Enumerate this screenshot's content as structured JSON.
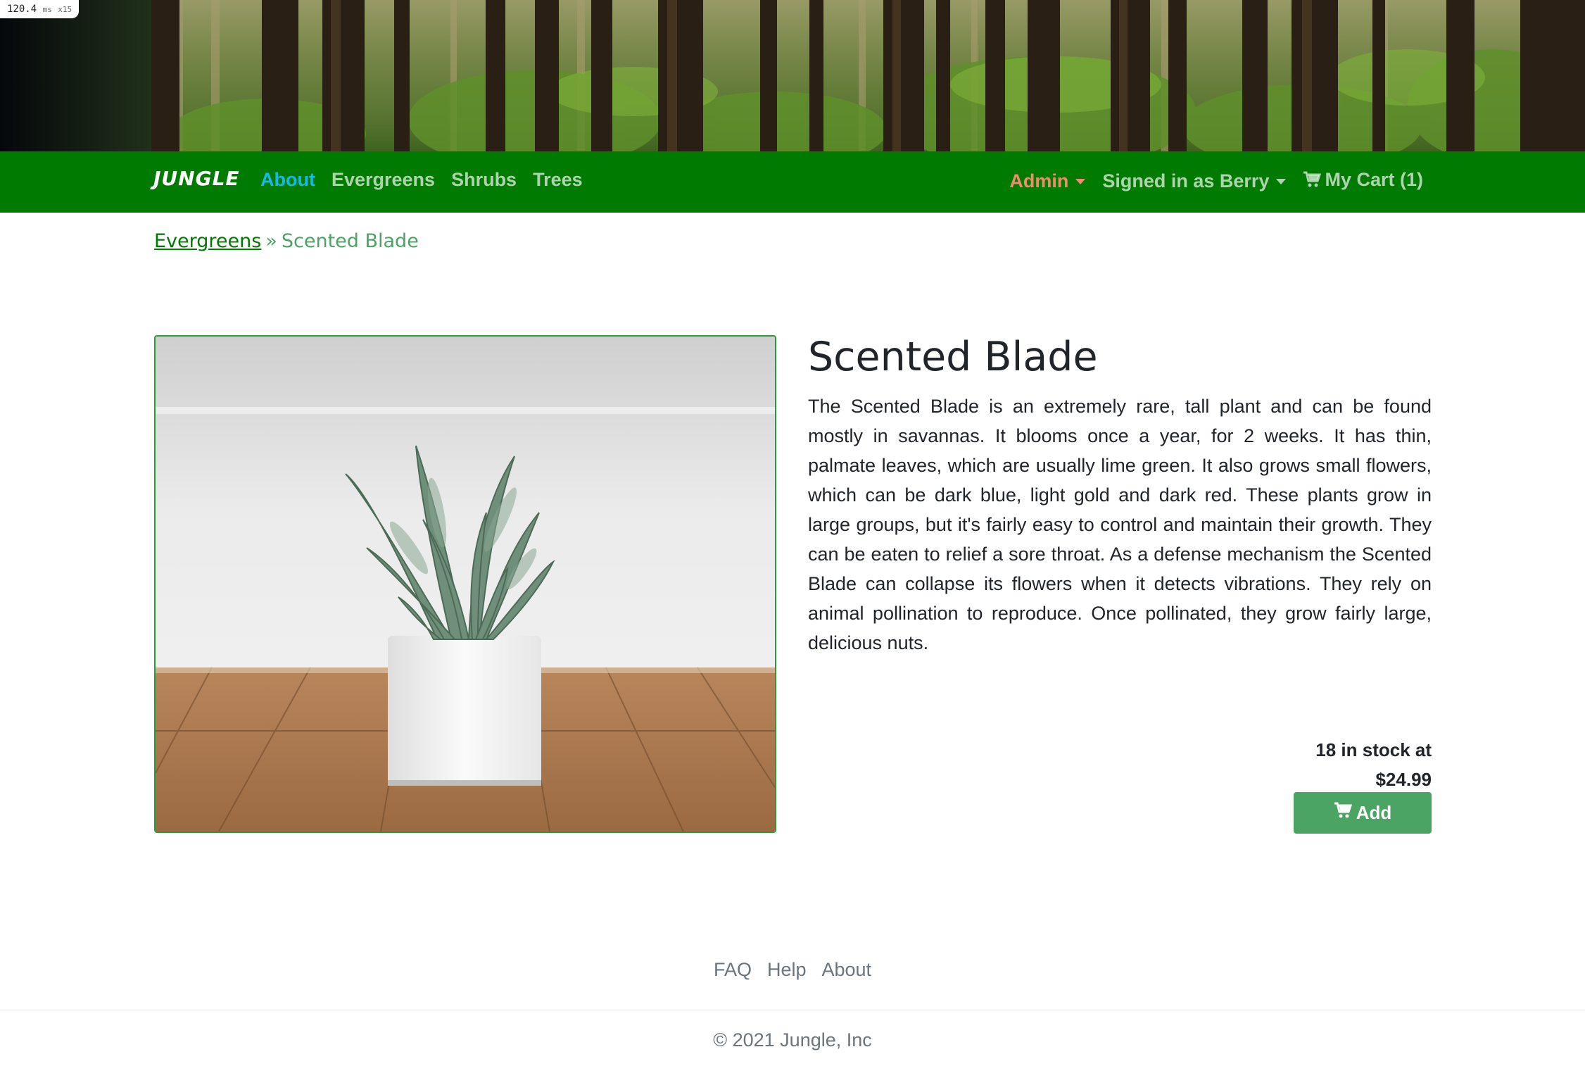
{
  "perf_badge": {
    "value": "120.4",
    "unit": "ms",
    "multiplier": "x15"
  },
  "navbar": {
    "brand": "JUNGLE",
    "links": [
      "About",
      "Evergreens",
      "Shrubs",
      "Trees"
    ],
    "active_link": "About",
    "admin_label": "Admin",
    "user_label": "Signed in as Berry",
    "cart_label": "My Cart (1)"
  },
  "breadcrumb": {
    "parent": "Evergreens",
    "separator": "»",
    "current": "Scented Blade"
  },
  "product": {
    "image_alt": "Succulent plant in a white square pot on a wooden floor",
    "title": "Scented Blade",
    "description": "The Scented Blade is an extremely rare, tall plant and can be found mostly in savannas. It blooms once a year, for 2 weeks. It has thin, palmate leaves, which are usually lime green. It also grows small flowers, which can be dark blue, light gold and dark red. These plants grow in large groups, but it's fairly easy to control and maintain their growth. They can be eaten to relief a sore throat. As a defense mechanism the Scented Blade can collapse its flowers when it detects vibrations. They rely on animal pollination to reproduce. Once pollinated, they grow fairly large, delicious nuts.",
    "stock_line": "18 in stock at",
    "price": "$24.99",
    "add_label": "Add"
  },
  "footer": {
    "links": [
      "FAQ",
      "Help",
      "About"
    ],
    "copyright": "© 2021 Jungle, Inc"
  },
  "colors": {
    "navbar_bg": "#007a00",
    "active_link": "#14b9e6",
    "admin_link": "#f08c6e",
    "accent_green": "#4ca464",
    "breadcrumb_link": "#007a00",
    "muted_text": "#6c757d"
  },
  "icons": {
    "cart": "shopping-cart-icon",
    "caret": "caret-down-icon"
  }
}
